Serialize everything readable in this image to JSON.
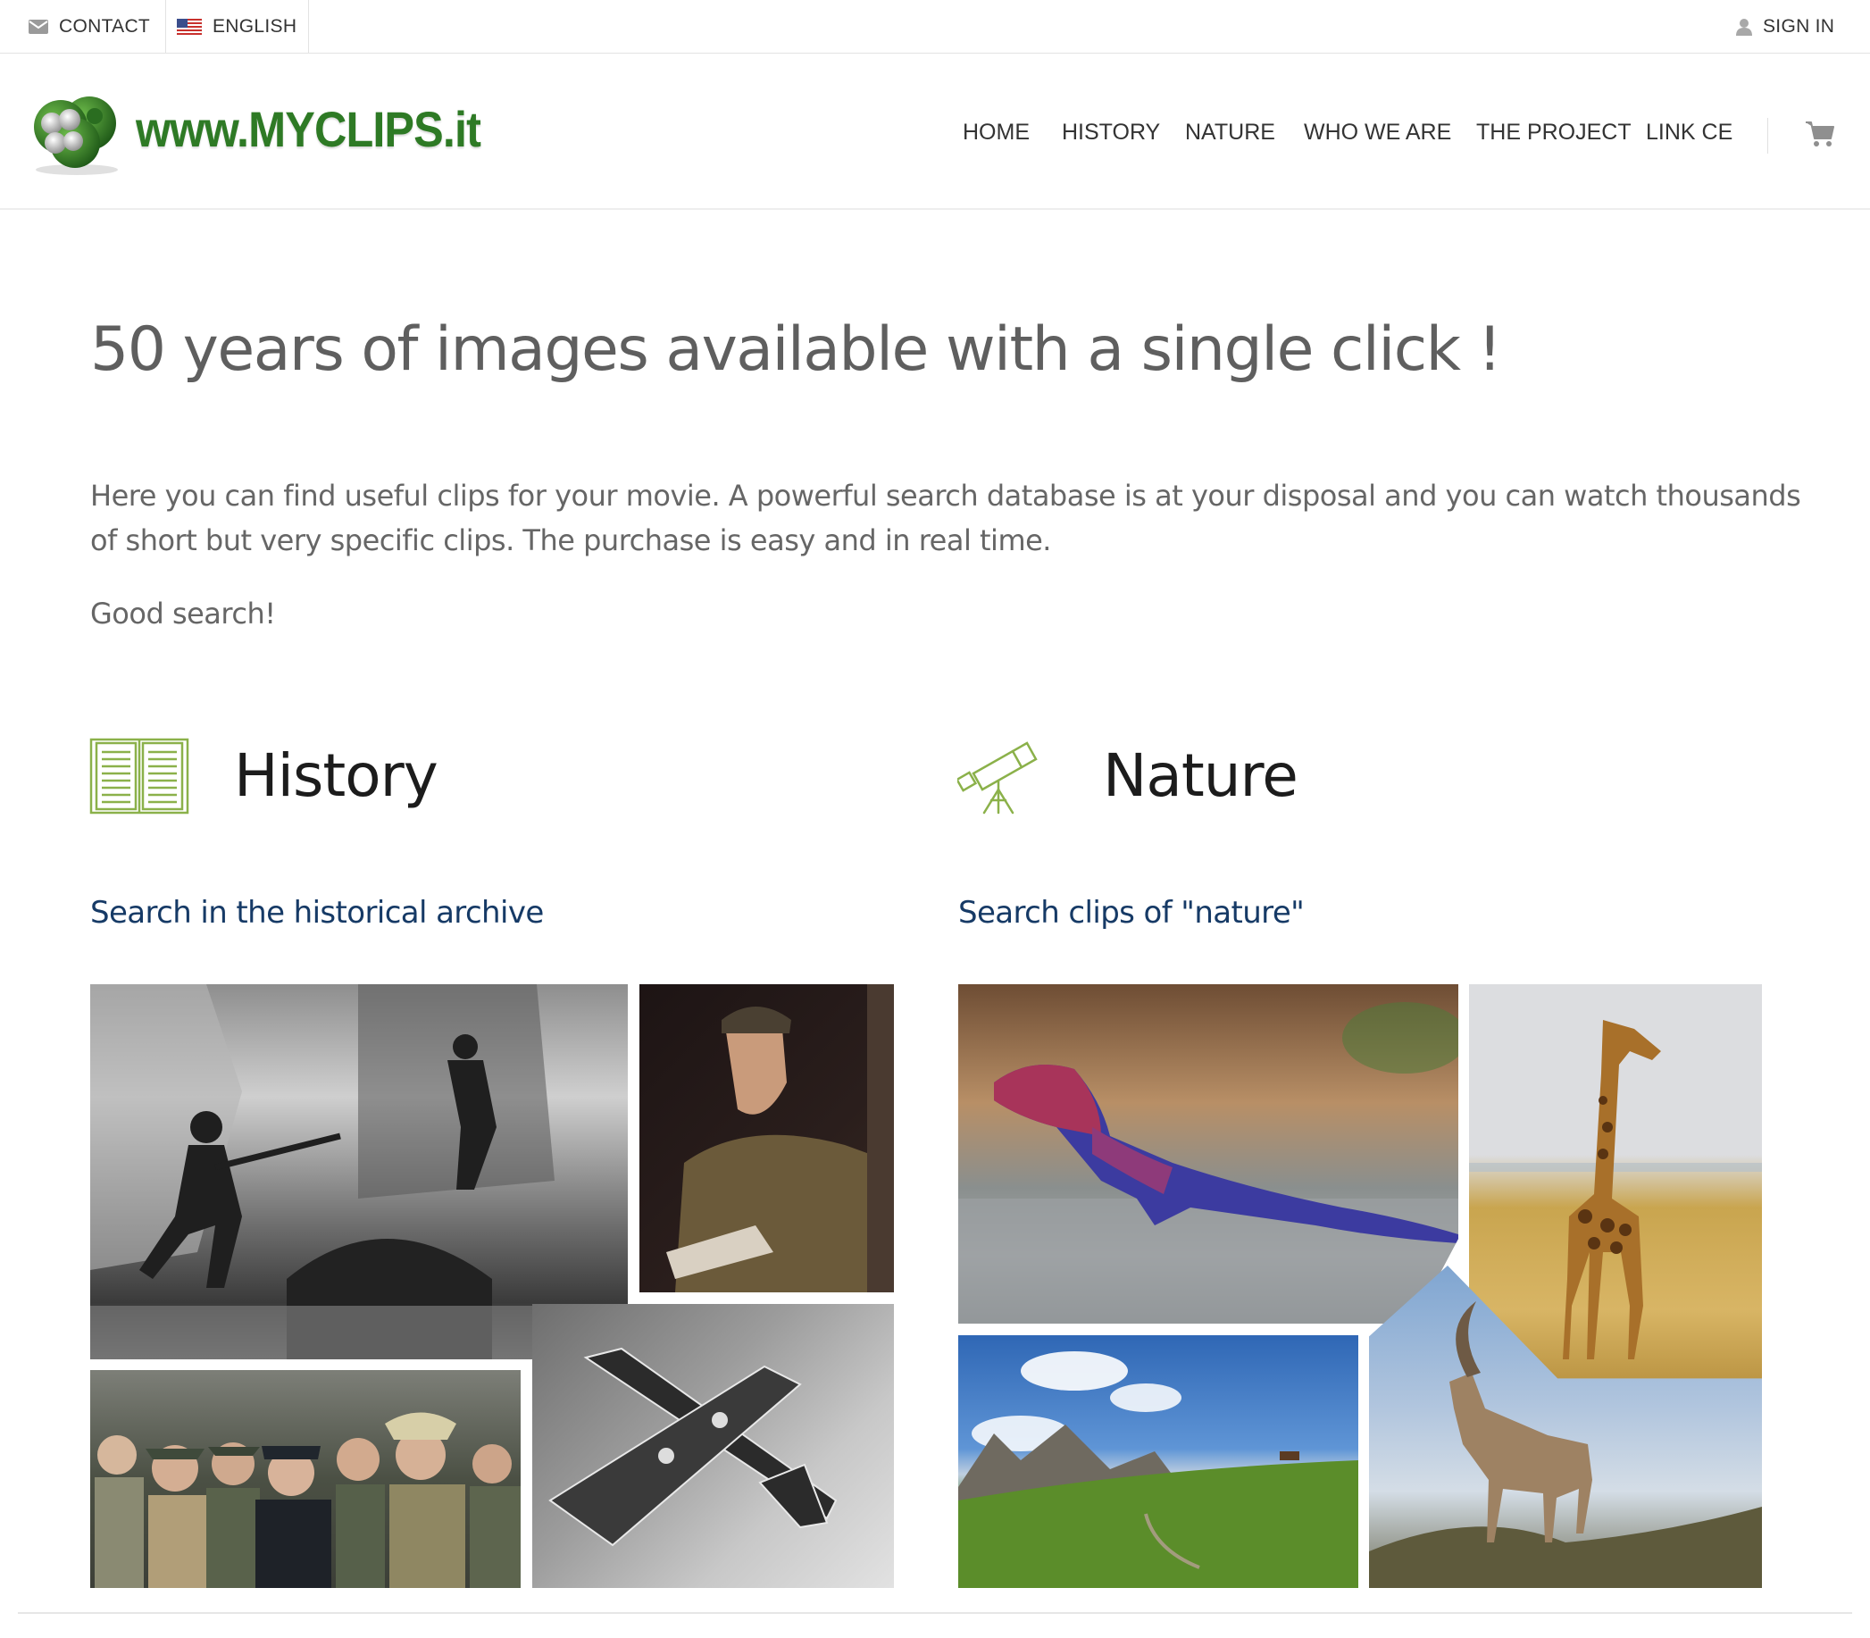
{
  "topbar": {
    "contact_label": "CONTACT",
    "language_label": "ENGLISH",
    "signin_label": "SIGN IN",
    "icons": [
      "envelope-icon",
      "us-flag-icon",
      "user-icon"
    ]
  },
  "header": {
    "logo_text": "www.MYCLIPS.it",
    "nav": [
      "HOME",
      "HISTORY",
      "NATURE",
      "WHO WE ARE",
      "THE PROJECT",
      "LINK CE"
    ],
    "cart_icon": "shopping-cart-icon"
  },
  "main": {
    "headline": "50 years of images available with a single click !",
    "intro": "Here you can find useful clips for your movie. A powerful search database is at your disposal and you can watch thousands of short but very specific clips. The purchase is easy and in real time.",
    "closing": "Good search!"
  },
  "sections": {
    "history": {
      "title": "History",
      "link": "Search in the historical archive",
      "icon": "open-book-icon"
    },
    "nature": {
      "title": "Nature",
      "link": "Search clips of \"nature\"",
      "icon": "telescope-icon"
    }
  },
  "colors": {
    "brand_green": "#2e7a25",
    "icon_green": "#8bb14a",
    "link_navy": "#163a66",
    "text_gray": "#666666"
  }
}
